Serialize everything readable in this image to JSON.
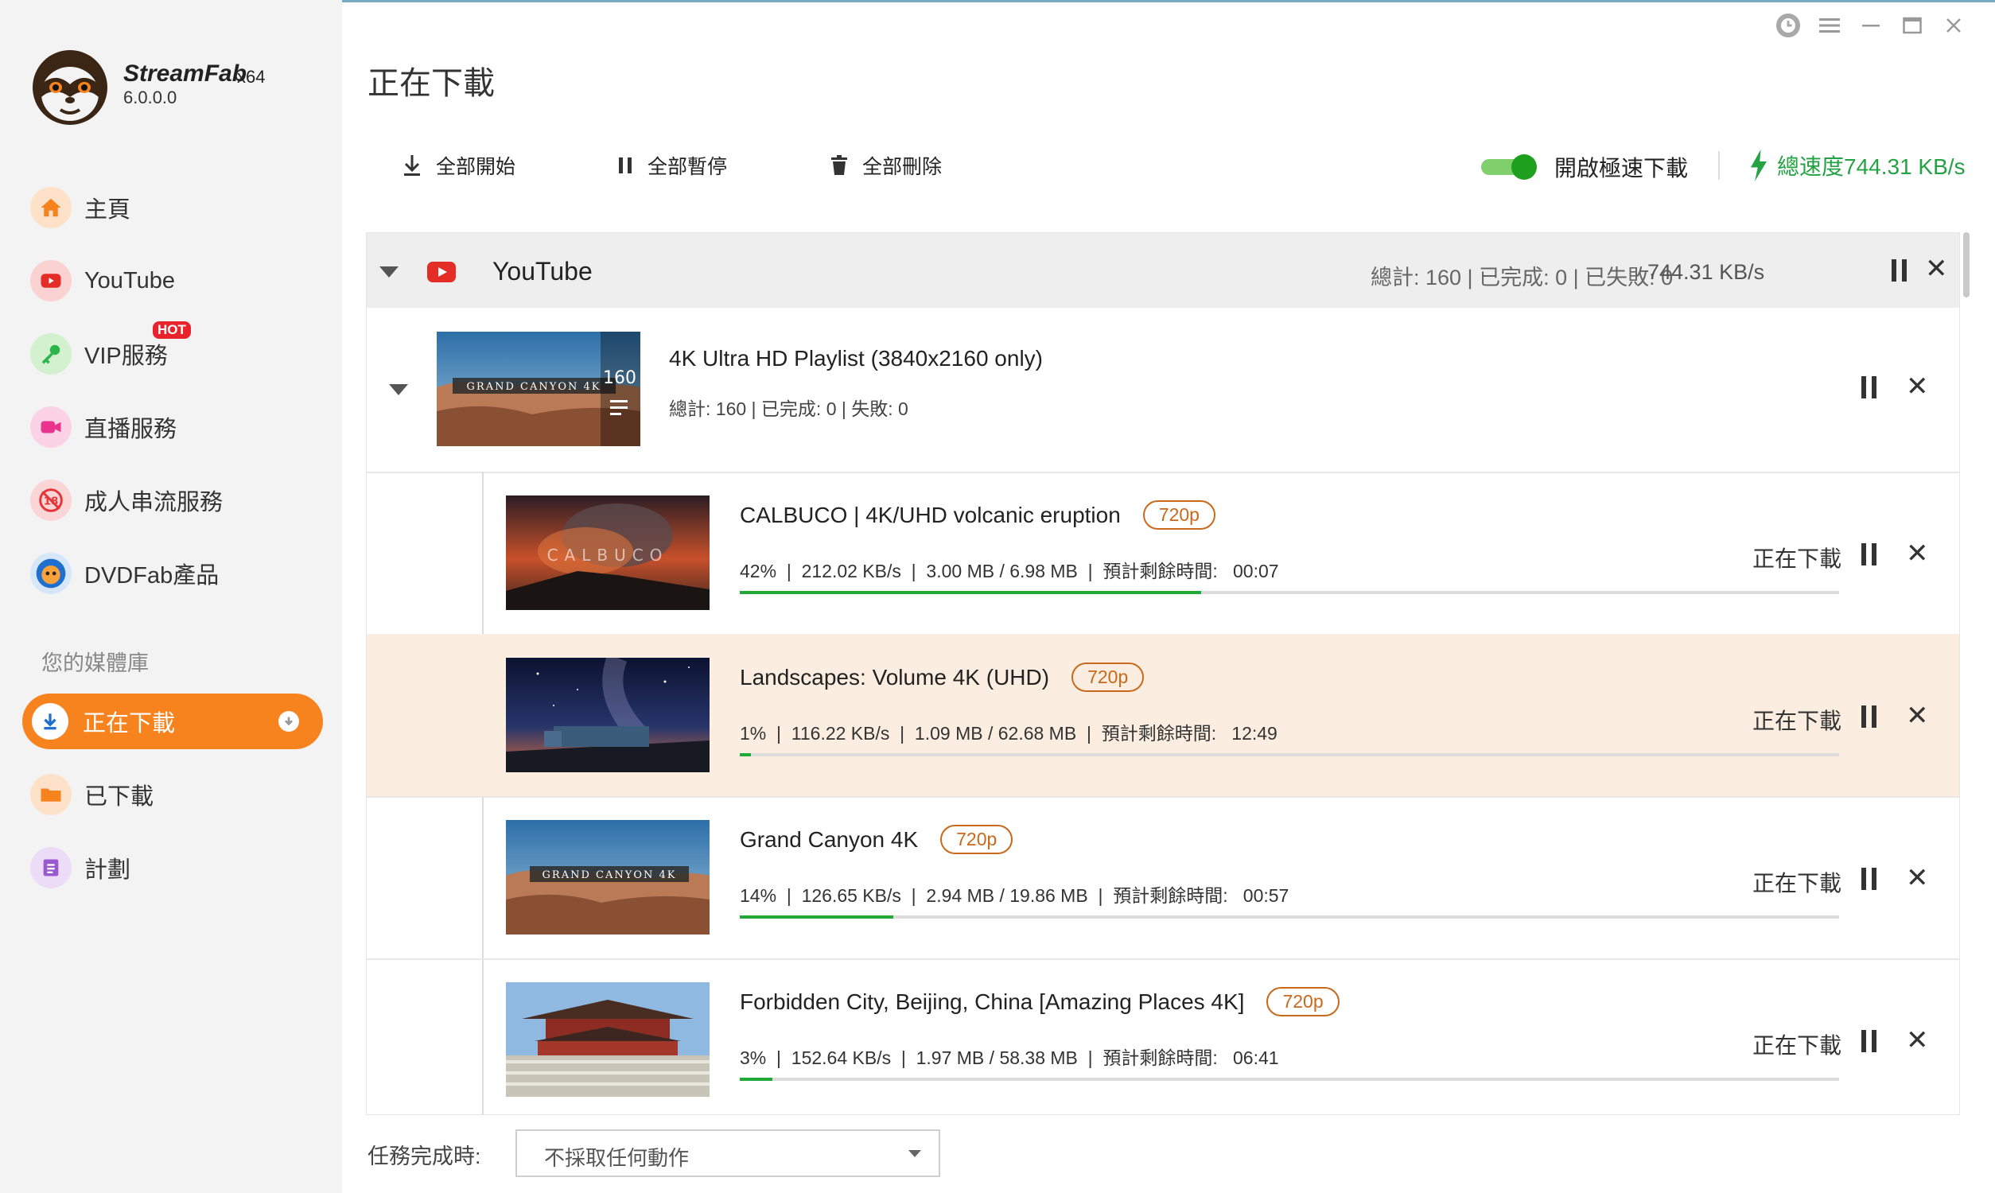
{
  "app": {
    "brand": "StreamFab",
    "arch": "x64",
    "version": "6.0.0.0"
  },
  "sidebar": {
    "items": [
      {
        "label": "主頁",
        "icon": "home-icon"
      },
      {
        "label": "YouTube",
        "icon": "youtube-icon"
      },
      {
        "label": "VIP服務",
        "icon": "key-icon",
        "badge": "HOT"
      },
      {
        "label": "直播服務",
        "icon": "camera-icon"
      },
      {
        "label": "成人串流服務",
        "icon": "adult-18-icon"
      },
      {
        "label": "DVDFab產品",
        "icon": "dvdfab-icon"
      }
    ],
    "library_title": "您的媒體庫",
    "library": [
      {
        "label": "正在下載",
        "active": true
      },
      {
        "label": "已下載"
      },
      {
        "label": "計劃"
      }
    ]
  },
  "header": {
    "title": "正在下載"
  },
  "toolbar": {
    "start_all": "全部開始",
    "pause_all": "全部暫停",
    "delete_all": "全部刪除",
    "turbo_label": "開啟極速下載",
    "turbo_on": true,
    "total_speed": "總速度744.31 KB/s"
  },
  "group": {
    "name": "YouTube",
    "stats": "總計: 160 | 已完成: 0 | 已失敗: 0",
    "speed": "744.31 KB/s"
  },
  "playlist": {
    "title": "4K Ultra HD Playlist (3840x2160 only)",
    "stats": "總計:   160  |   已完成:   0  |   失敗:   0",
    "count": "160",
    "thumb_label": "GRAND CANYON 4K"
  },
  "items": [
    {
      "title": "CALBUCO | 4K/UHD volcanic eruption",
      "quality": "720p",
      "stats": "42%  |  212.02 KB/s  |  3.00 MB / 6.98 MB  |  預計剩餘時間:   00:07",
      "progress": 0.42,
      "status": "正在下載",
      "thumb_label": "CALBUCO"
    },
    {
      "title": "Landscapes: Volume 4K (UHD)",
      "quality": "720p",
      "stats": "1%  |  116.22 KB/s  |  1.09 MB / 62.68 MB  |  預計剩餘時間:   12:49",
      "progress": 0.01,
      "status": "正在下載",
      "highlighted": true,
      "thumb_label": ""
    },
    {
      "title": "Grand Canyon 4K",
      "quality": "720p",
      "stats": "14%  |  126.65 KB/s  |  2.94 MB / 19.86 MB  |  預計剩餘時間:   00:57",
      "progress": 0.14,
      "status": "正在下載",
      "thumb_label": "GRAND CANYON 4K"
    },
    {
      "title": "Forbidden City, Beijing, China  [Amazing Places 4K]",
      "quality": "720p",
      "stats": "3%  |  152.64 KB/s  |  1.97 MB / 58.38 MB  |  預計剩餘時間:   06:41",
      "progress": 0.03,
      "status": "正在下載",
      "thumb_label": ""
    }
  ],
  "footer": {
    "label": "任務完成時:",
    "action": "不採取任何動作"
  },
  "colors": {
    "accent": "#f7831e",
    "green": "#22a836",
    "badge": "#c8691b"
  }
}
